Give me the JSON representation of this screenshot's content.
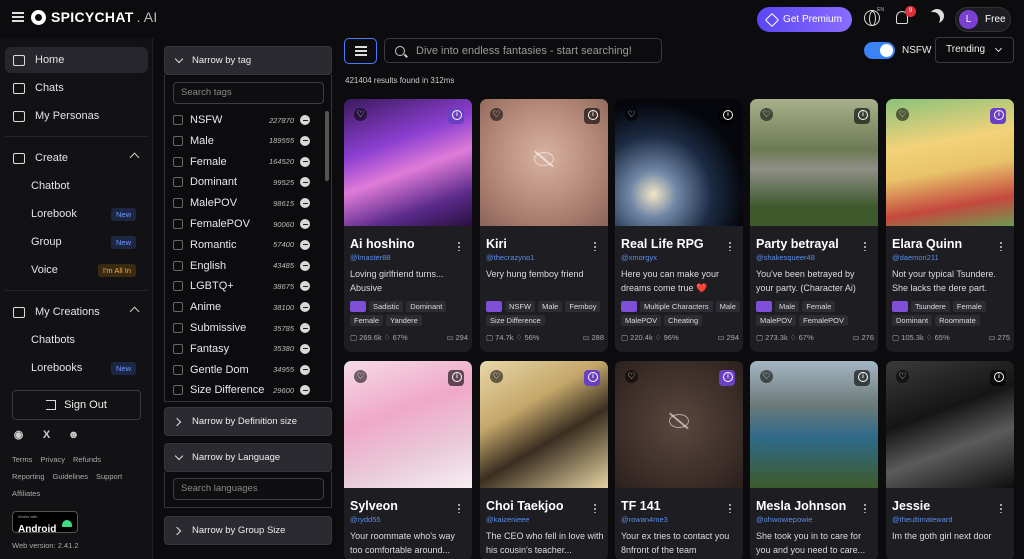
{
  "app": {
    "logo_main": "SPICYCHAT",
    "logo_dot": ".",
    "logo_ai": "AI"
  },
  "topbar": {
    "premium": "Get Premium",
    "lang": "EN",
    "notifications": "9",
    "avatar_letter": "L",
    "plan": "Free"
  },
  "sidebar": {
    "home": "Home",
    "chats": "Chats",
    "personas": "My Personas",
    "create": "Create",
    "chatbot": "Chatbot",
    "lorebook": "Lorebook",
    "group": "Group",
    "voice": "Voice",
    "new": "New",
    "all_in": "I'm All In",
    "my_creations": "My Creations",
    "chatbots": "Chatbots",
    "lorebooks": "Lorebooks",
    "sign_out": "Sign Out",
    "links1": [
      "Terms",
      "Privacy",
      "Refunds"
    ],
    "links2": [
      "Reporting",
      "Guidelines",
      "Support"
    ],
    "links3": [
      "Affiliates"
    ],
    "android_small": "Works with",
    "android": "Android",
    "version": "Web version: 2.41.2"
  },
  "filters": {
    "tag_header": "Narrow by tag",
    "tag_placeholder": "Search tags",
    "tags": [
      {
        "name": "NSFW",
        "count": "227870"
      },
      {
        "name": "Male",
        "count": "189555"
      },
      {
        "name": "Female",
        "count": "164520"
      },
      {
        "name": "Dominant",
        "count": "99525"
      },
      {
        "name": "MalePOV",
        "count": "98615"
      },
      {
        "name": "FemalePOV",
        "count": "90060"
      },
      {
        "name": "Romantic",
        "count": "57400"
      },
      {
        "name": "English",
        "count": "43485"
      },
      {
        "name": "LGBTQ+",
        "count": "38675"
      },
      {
        "name": "Anime",
        "count": "38100"
      },
      {
        "name": "Submissive",
        "count": "35785"
      },
      {
        "name": "Fantasy",
        "count": "35380"
      },
      {
        "name": "Gentle Dom",
        "count": "34955"
      },
      {
        "name": "Size Difference",
        "count": "29600"
      }
    ],
    "definition_header": "Narrow by Definition size",
    "language_header": "Narrow by Language",
    "language_placeholder": "Search languages",
    "group_header": "Narrow by Group Size"
  },
  "main": {
    "search_placeholder": "Dive into endless fantasies - start searching!",
    "nsfw_label": "NSFW",
    "sort": "Trending",
    "results": "421404 results found in 312ms"
  },
  "cards": [
    {
      "name": "Ai hoshino",
      "handle": "@lmaster88",
      "desc": "Loving girlfriend turns... Abusive",
      "tags": [
        "Sadistic",
        "Dominant",
        "Female",
        "Yandere"
      ],
      "views": "269.6k",
      "rating": "67%",
      "msgs": "294"
    },
    {
      "name": "Kiri",
      "handle": "@thecrazyno1",
      "desc": "Very hung femboy friend",
      "tags": [
        "NSFW",
        "Male",
        "Femboy",
        "Size Difference"
      ],
      "views": "74.7k",
      "rating": "56%",
      "msgs": "288"
    },
    {
      "name": "Real Life RPG",
      "handle": "@xmorgyx",
      "desc": "Here you can make your dreams come true ❤️",
      "tags": [
        "Multiple Characters",
        "Male",
        "MalePOV",
        "Cheating"
      ],
      "views": "220.4k",
      "rating": "96%",
      "msgs": "294"
    },
    {
      "name": "Party betrayal",
      "handle": "@shakesqueer48",
      "desc": "You've been betrayed by your party. (Character Ai)",
      "tags": [
        "Male",
        "Female",
        "MalePOV",
        "FemalePOV"
      ],
      "views": "273.3k",
      "rating": "67%",
      "msgs": "276"
    },
    {
      "name": "Elara Quinn",
      "handle": "@daemon211",
      "desc": "Not your typical Tsundere. She lacks the dere part.",
      "tags": [
        "Tsundere",
        "Female",
        "Dominant",
        "Roommate"
      ],
      "views": "105.3k",
      "rating": "65%",
      "msgs": "275"
    },
    {
      "name": "Sylveon",
      "handle": "@rydd55",
      "desc": "Your roommate who's way too comfortable around..."
    },
    {
      "name": "Choi Taekjoo",
      "handle": "@kaizenieee",
      "desc": "The CEO who fell in love with his cousin's teacher..."
    },
    {
      "name": "TF 141",
      "handle": "@rowan4me3",
      "desc": "Your ex tries to contact you 8nfront of the team"
    },
    {
      "name": "Mesla Johnson",
      "handle": "@ohwowiepowie",
      "desc": "She took you in to care for you and you need to care..."
    },
    {
      "name": "Jessie",
      "handle": "@theultimateward",
      "desc": "Im the goth girl next door"
    }
  ],
  "icons": {
    "menu": "hamburger-icon",
    "premium": "diamond-icon",
    "globe": "globe-icon",
    "bell": "bell-icon",
    "theme": "moon-icon",
    "heart": "heart-icon",
    "info": "info-icon",
    "hidden": "eye-off-icon"
  },
  "colors": {
    "accent": "#3b82f6",
    "premium": "#6d52f6",
    "purple_tag": "#7c4fd6",
    "new_badge": "#6f9bff"
  }
}
